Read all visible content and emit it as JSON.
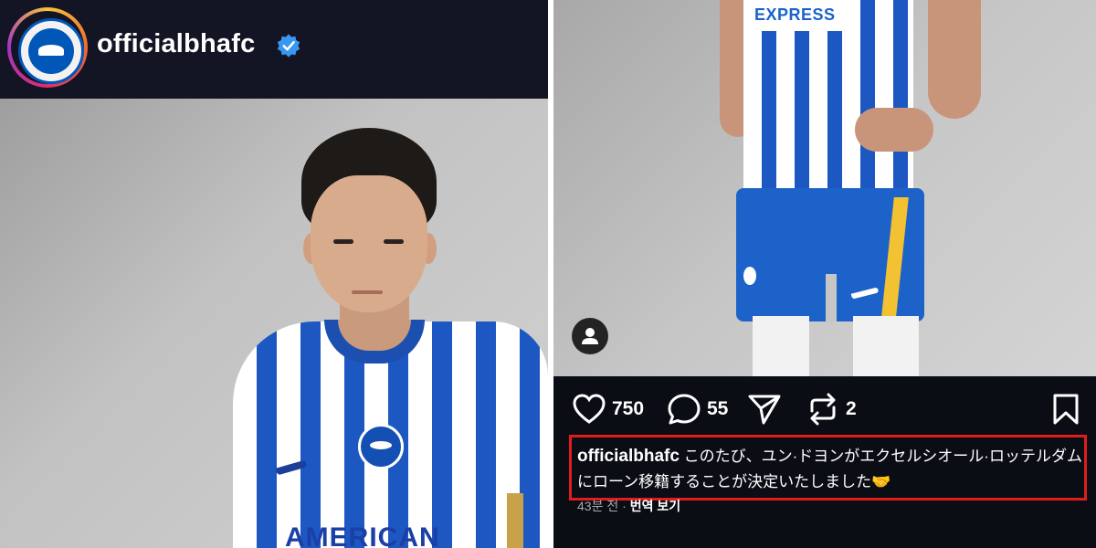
{
  "left_panel": {
    "header": {
      "username": "officialbhafc",
      "verified": true
    },
    "photo": {
      "shirt_sponsor": "AMERICAN"
    }
  },
  "right_panel": {
    "photo": {
      "shirt_sponsor": "EXPRESS"
    },
    "actions": {
      "likes": "750",
      "comments": "55",
      "reposts": "2"
    },
    "caption": {
      "username": "officialbhafc",
      "text": "このたび、ユン·ドヨンがエクセルシオール·ロッテルダムにローン移籍することが決定いたしました🤝"
    },
    "meta": {
      "time": "43분 전",
      "translate": "번역 보기"
    }
  },
  "colors": {
    "header_bg": "#131524",
    "post_bg": "#0b0d14",
    "verified_blue": "#3897f0",
    "highlight_red": "#e01c1c",
    "brighton_blue": "#1d58c2"
  }
}
